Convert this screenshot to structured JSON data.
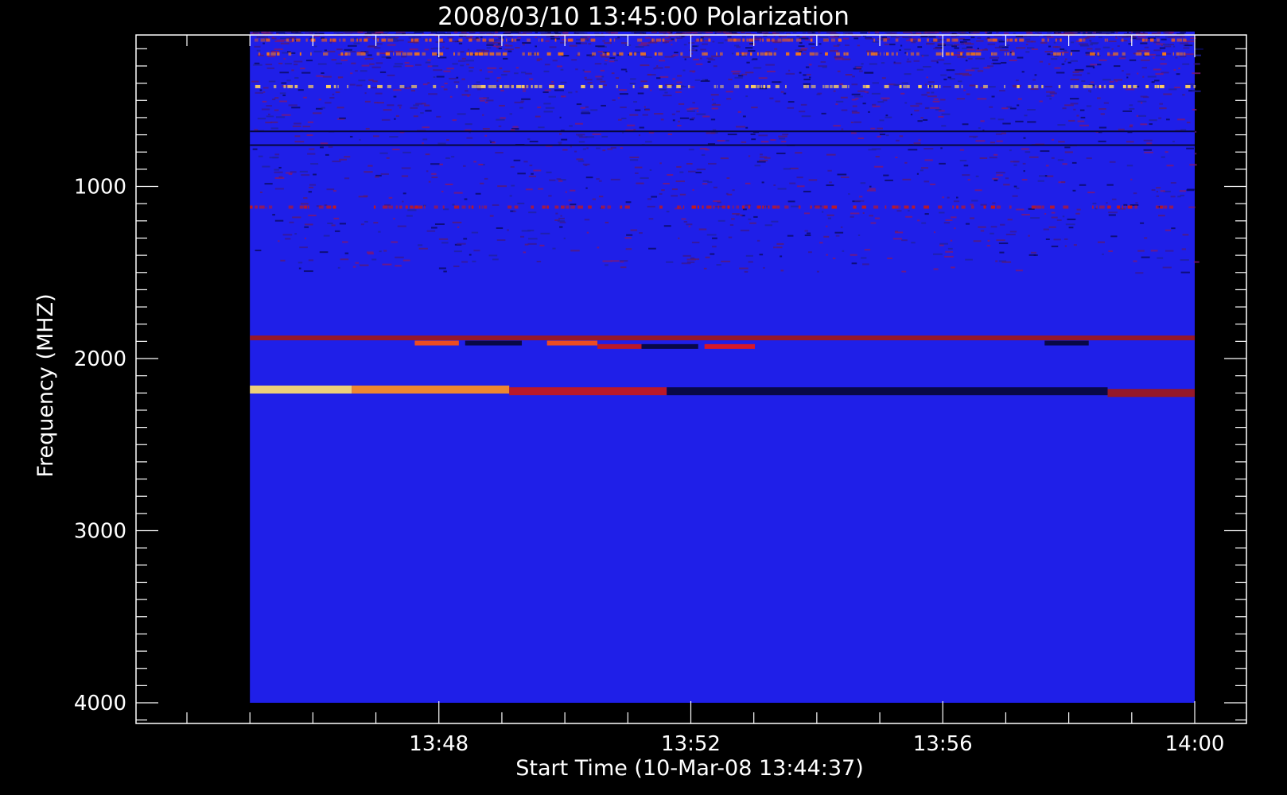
{
  "chart_data": {
    "type": "heatmap",
    "title": "2008/03/10 13:45:00 Polarization",
    "xlabel": "Start Time (10-Mar-08 13:44:37)",
    "ylabel": "Frequency (MHZ)",
    "x_tick_labels": [
      "13:48",
      "13:52",
      "13:56",
      "14:00"
    ],
    "x_tick_values_min": [
      3.383,
      7.383,
      11.383,
      15.383
    ],
    "x_range_min": [
      -0.617,
      15.383
    ],
    "data_x_range_min": [
      0.383,
      15.383
    ],
    "y_ticks": [
      1000,
      2000,
      3000,
      4000
    ],
    "y_range": [
      120,
      4120
    ],
    "data_y_range": [
      100,
      4000
    ],
    "y_inverted": true,
    "colors": {
      "background": "#000000",
      "axes": "#ffffff",
      "base": "#1f1fe8",
      "dark_band": "#07073a",
      "red_band": "#c81818",
      "orange_band": "#ff7a10",
      "yellow_band": "#ffe070"
    },
    "features": [
      {
        "kind": "noise_band",
        "freq": 150,
        "t_start": 0.383,
        "t_end": 15.383,
        "color": "#e85a20"
      },
      {
        "kind": "noise_band",
        "freq": 230,
        "t_start": 0.383,
        "t_end": 15.383,
        "color": "#ff7a10"
      },
      {
        "kind": "noise_band",
        "freq": 420,
        "t_start": 0.383,
        "t_end": 15.383,
        "color": "#ffd060"
      },
      {
        "kind": "dark_line",
        "freq": 680,
        "t_start": 0.383,
        "t_end": 15.383,
        "color": "#07073a"
      },
      {
        "kind": "dark_line",
        "freq": 760,
        "t_start": 0.383,
        "t_end": 15.383,
        "color": "#07073a"
      },
      {
        "kind": "noise_band",
        "freq": 1120,
        "t_start": 0.383,
        "t_end": 15.0,
        "color": "#c81818"
      },
      {
        "kind": "band",
        "freq": 1880,
        "t_start": 0.383,
        "t_end": 15.383,
        "color": "#a01818"
      },
      {
        "kind": "band",
        "freq": 1910,
        "t_start": 3.0,
        "t_end": 3.7,
        "color": "#ff5010"
      },
      {
        "kind": "band",
        "freq": 1910,
        "t_start": 3.8,
        "t_end": 4.7,
        "color": "#07073a"
      },
      {
        "kind": "band",
        "freq": 1910,
        "t_start": 5.1,
        "t_end": 5.9,
        "color": "#ff5010"
      },
      {
        "kind": "band",
        "freq": 1930,
        "t_start": 5.9,
        "t_end": 6.6,
        "color": "#c81818"
      },
      {
        "kind": "band",
        "freq": 1930,
        "t_start": 6.6,
        "t_end": 7.5,
        "color": "#07073a"
      },
      {
        "kind": "band",
        "freq": 1930,
        "t_start": 7.6,
        "t_end": 8.4,
        "color": "#e81818"
      },
      {
        "kind": "band",
        "freq": 1910,
        "t_start": 13.0,
        "t_end": 13.7,
        "color": "#07073a"
      },
      {
        "kind": "band",
        "freq": 2180,
        "t_start": 0.383,
        "t_end": 2.0,
        "color": "#ffe070"
      },
      {
        "kind": "band",
        "freq": 2180,
        "t_start": 2.0,
        "t_end": 4.5,
        "color": "#ff9020"
      },
      {
        "kind": "band",
        "freq": 2190,
        "t_start": 4.5,
        "t_end": 7.0,
        "color": "#c81818"
      },
      {
        "kind": "band",
        "freq": 2190,
        "t_start": 7.0,
        "t_end": 14.0,
        "color": "#07073a"
      },
      {
        "kind": "band",
        "freq": 2200,
        "t_start": 14.0,
        "t_end": 15.383,
        "color": "#a01818"
      }
    ]
  }
}
